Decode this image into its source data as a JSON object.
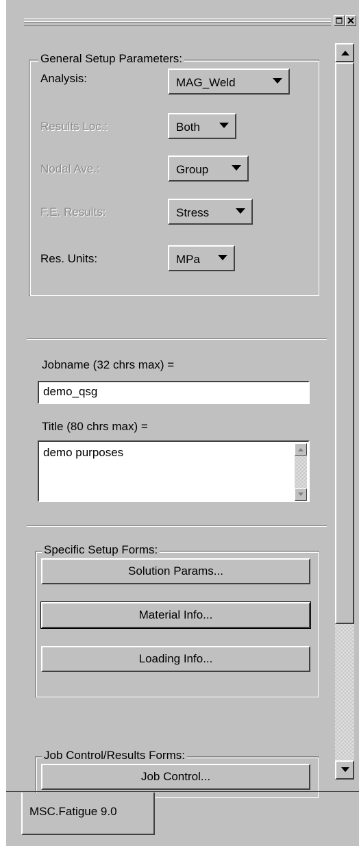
{
  "window": {
    "restore_icon": "restore-icon",
    "close_icon": "close-icon"
  },
  "general_setup": {
    "title": "General Setup Parameters:",
    "rows": [
      {
        "label": "Analysis:",
        "value": "MAG_Weld",
        "enabled": true
      },
      {
        "label": "Results Loc.:",
        "value": "Both",
        "enabled": false
      },
      {
        "label": "Nodal Ave.:",
        "value": "Group",
        "enabled": false
      },
      {
        "label": "F.E. Results:",
        "value": "Stress",
        "enabled": false
      },
      {
        "label": "Res. Units:",
        "value": "MPa",
        "enabled": true
      }
    ]
  },
  "job": {
    "jobname_label": "Jobname (32 chrs max) =",
    "jobname_value": "demo_qsg",
    "title_label": "Title (80 chrs max) =",
    "title_value": "demo purposes"
  },
  "specific_setup": {
    "title": "Specific Setup Forms:",
    "buttons": [
      "Solution Params...",
      "Material Info...",
      "Loading Info..."
    ]
  },
  "job_control": {
    "title": "Job Control/Results Forms:",
    "buttons": [
      "Job Control..."
    ]
  },
  "tab": {
    "label": "MSC.Fatigue 9.0"
  },
  "colors": {
    "panel_bg": "#c0c0c0",
    "disabled_text": "#8a8a8a"
  }
}
